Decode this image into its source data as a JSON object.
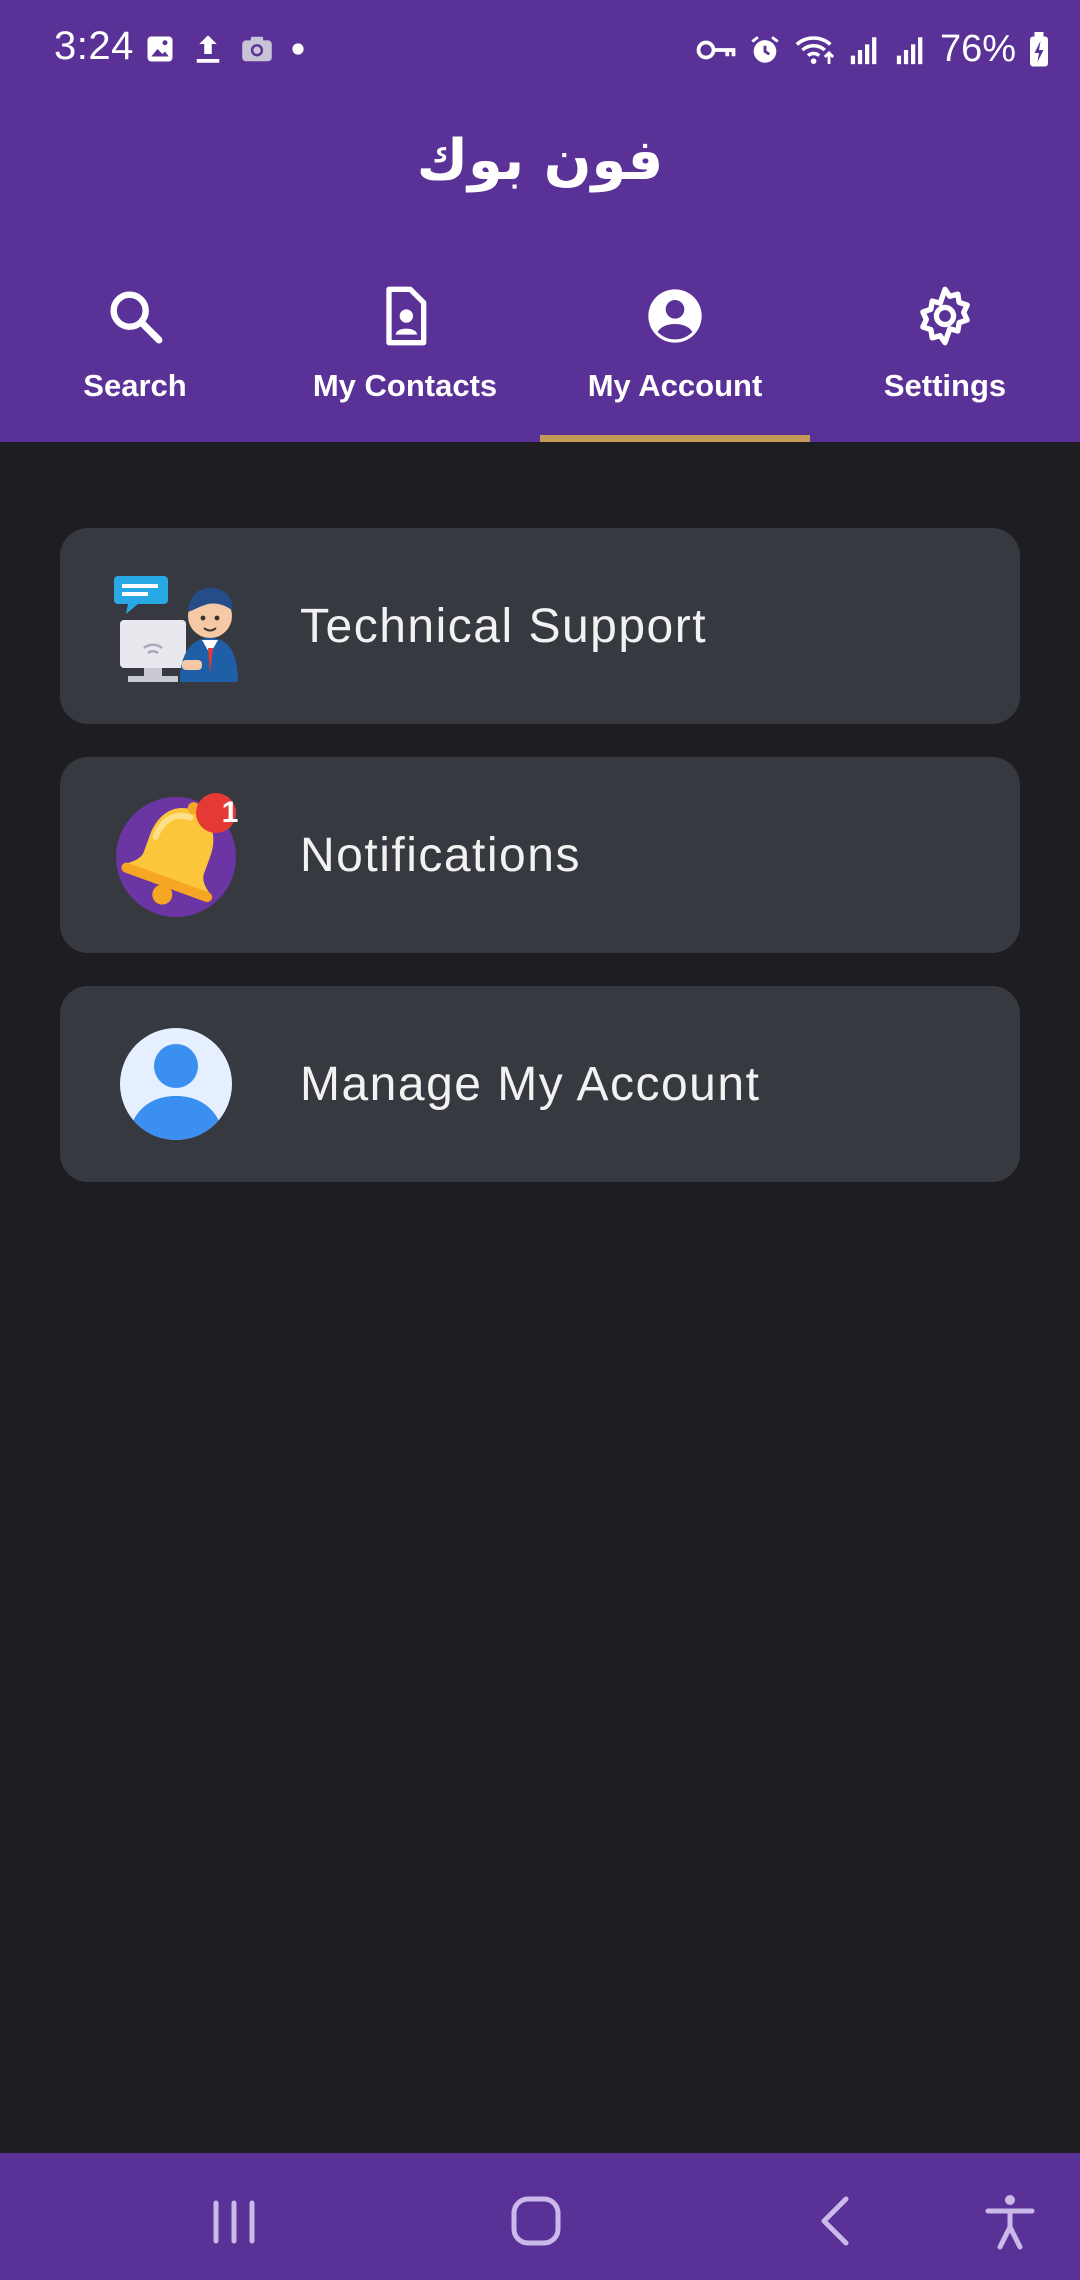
{
  "status_bar": {
    "time": "3:24",
    "battery": "76%",
    "left_icons": [
      "image-icon",
      "upload-icon",
      "camera-icon",
      "dot-icon"
    ],
    "right_icons": [
      "vpn-key-icon",
      "alarm-icon",
      "wifi-icon",
      "signal-icon",
      "signal-icon",
      "battery-charging-icon"
    ]
  },
  "app": {
    "title": "فون بوك"
  },
  "tabs": [
    {
      "label": "Search",
      "icon": "search-icon"
    },
    {
      "label": "My Contacts",
      "icon": "contact-card-icon"
    },
    {
      "label": "My Account",
      "icon": "account-circle-icon",
      "active": true
    },
    {
      "label": "Settings",
      "icon": "gear-icon"
    }
  ],
  "menu": [
    {
      "label": "Technical Support",
      "icon": "support-agent-icon"
    },
    {
      "label": "Notifications",
      "icon": "bell-icon",
      "badge": "1"
    },
    {
      "label": "Manage My Account",
      "icon": "user-avatar-icon"
    }
  ],
  "colors": {
    "primary": "#5a3196",
    "accent": "#c49a5a",
    "background": "#1e1d21",
    "card": "#36393f",
    "badge": "#e53935"
  }
}
